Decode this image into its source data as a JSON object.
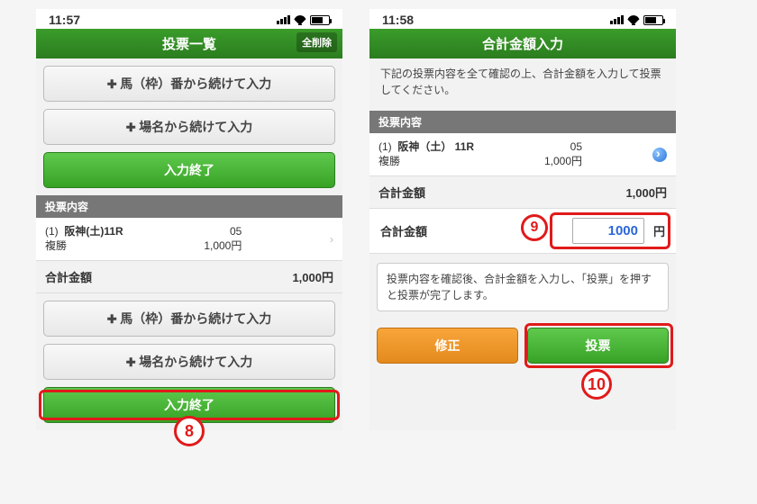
{
  "left": {
    "status_time": "11:57",
    "header_title": "投票一覧",
    "header_delete": "全削除",
    "btn_horse": "馬（枠）番から続けて入力",
    "btn_place": "場名から続けて入力",
    "btn_finish": "入力終了",
    "section_vote": "投票内容",
    "vote": {
      "idx": "(1)",
      "line1": "阪神(土)11R",
      "line2": "複勝",
      "num": "05",
      "amt": "1,000円"
    },
    "total_label": "合計金額",
    "total_value": "1,000円"
  },
  "right": {
    "status_time": "11:58",
    "header_title": "合計金額入力",
    "instruct": "下記の投票内容を全て確認の上、合計金額を入力して投票してください。",
    "section_vote": "投票内容",
    "vote": {
      "idx": "(1)",
      "line1": "阪神（土） 11R",
      "line2": "複勝",
      "num": "05",
      "amt": "1,000円"
    },
    "total_label": "合計金額",
    "total_value": "1,000円",
    "input_label": "合計金額",
    "input_value": "1000",
    "input_unit": "円",
    "note": "投票内容を確認後、合計金額を入力し、「投票」を押すと投票が完了します。",
    "btn_fix": "修正",
    "btn_vote": "投票"
  },
  "callouts": {
    "c8": "8",
    "c9": "9",
    "c10": "10"
  }
}
